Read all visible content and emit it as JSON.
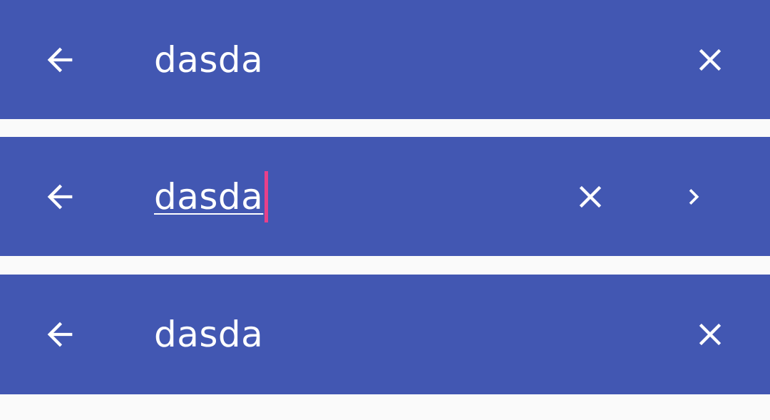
{
  "colors": {
    "bar_background": "#4257b2",
    "page_background": "#fafafa",
    "text": "#ffffff",
    "caret": "#e8408a"
  },
  "search_bars": [
    {
      "state": "collapsed",
      "query": "dasda",
      "icons": [
        "arrow-left-icon",
        "close-icon"
      ]
    },
    {
      "state": "editing",
      "query": "dasda",
      "icons": [
        "arrow-left-icon",
        "close-icon",
        "chevron-right-icon"
      ]
    },
    {
      "state": "collapsed",
      "query": "dasda",
      "icons": [
        "arrow-left-icon",
        "close-icon"
      ]
    }
  ]
}
